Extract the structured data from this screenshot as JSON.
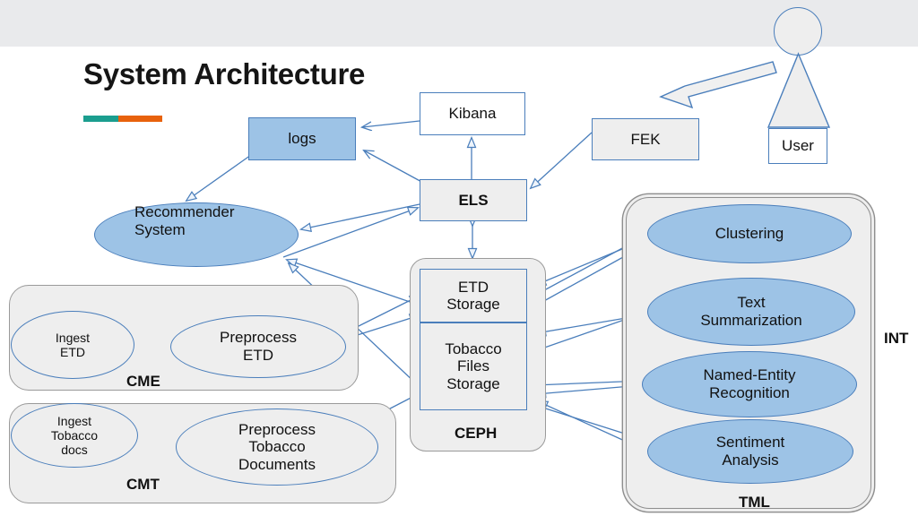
{
  "page": {
    "title": "System Architecture",
    "accent_colors": [
      "#1b9e8f",
      "#e8620c"
    ],
    "background": "#ffffff",
    "band_color": "#e9eaec"
  },
  "palette": {
    "node_border": "#4a7ebb",
    "node_fill_gray": "#eeeeee",
    "node_fill_blue": "#9dc3e6",
    "container_border": "#9a9a9a",
    "connector": "#4a7ebb"
  },
  "nodes": {
    "logs": {
      "label": "logs",
      "fill": "#9dc3e6"
    },
    "kibana": {
      "label": "Kibana",
      "fill": "#ffffff"
    },
    "fek": {
      "label": "FEK",
      "fill": "#eeeeee"
    },
    "els": {
      "label": "ELS",
      "fill": "#eeeeee"
    },
    "etd_storage": {
      "label": "ETD\nStorage",
      "line1": "ETD",
      "line2": "Storage"
    },
    "tobacco_storage": {
      "line1": "Tobacco",
      "line2": "Files",
      "line3": "Storage"
    },
    "recommender": {
      "line1": "Recommender",
      "line2": "System",
      "fill": "#9dc3e6"
    },
    "ingest_etd": {
      "line1": "Ingest",
      "line2": "ETD"
    },
    "preprocess_etd": {
      "line1": "Preprocess",
      "line2": "ETD"
    },
    "ingest_tobacco": {
      "line1": "Ingest",
      "line2": "Tobacco",
      "line3": "docs"
    },
    "preprocess_tobacco": {
      "line1": "Preprocess",
      "line2": "Tobacco",
      "line3": "Documents"
    },
    "clustering": {
      "label": "Clustering",
      "fill": "#9dc3e6"
    },
    "text_summarization": {
      "line1": "Text",
      "line2": "Summarization",
      "fill": "#9dc3e6"
    },
    "ner": {
      "line1": "Named-Entity",
      "line2": "Recognition",
      "fill": "#9dc3e6"
    },
    "sentiment": {
      "line1": "Sentiment",
      "line2": "Analysis",
      "fill": "#9dc3e6"
    },
    "user": {
      "label": "User"
    }
  },
  "containers": {
    "ceph": {
      "label": "CEPH"
    },
    "tml": {
      "label": "TML"
    },
    "cme": {
      "label": "CME"
    },
    "cmt": {
      "label": "CMT"
    },
    "int": {
      "label": "INT"
    }
  },
  "icons": {
    "actor": "user-actor-icon",
    "block_arrow": "block-arrow-icon"
  }
}
